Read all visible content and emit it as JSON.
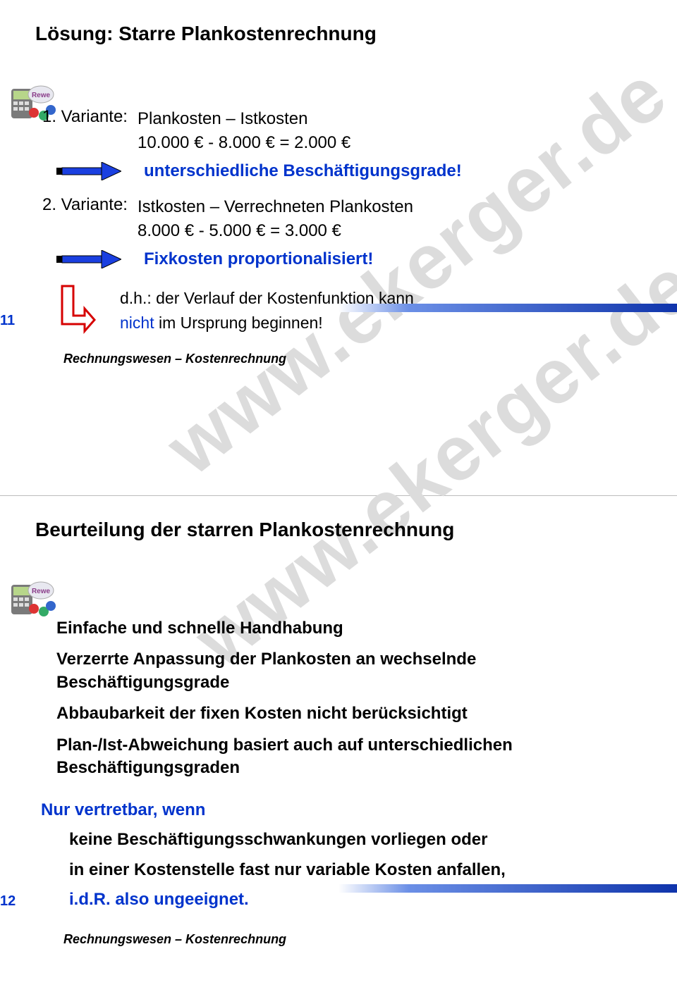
{
  "watermark": "www.ekerger.de",
  "slide1": {
    "title": "Lösung: Starre Plankostenrechnung",
    "var1_label": "1. Variante:",
    "var1_text1": "Plankosten – Istkosten",
    "var1_text2": "10.000 € - 8.000 € = 2.000 €",
    "arrow1_note": "unterschiedliche Beschäftigungsgrade!",
    "var2_label": "2. Variante:",
    "var2_text1": "Istkosten – Verrechneten Plankosten",
    "var2_text2": "8.000 € - 5.000 € = 3.000 €",
    "arrow2_note": "Fixkosten proportionalisiert!",
    "down_note_1": "d.h.: der Verlauf der Kostenfunktion kann",
    "down_note_nicht": "nicht",
    "down_note_2": " im Ursprung beginnen!",
    "footer": "Rechnungswesen – Kostenrechnung",
    "pagenum": "11"
  },
  "slide2": {
    "title": "Beurteilung der starren Plankostenrechnung",
    "bullets": [
      "Einfache und schnelle Handhabung",
      "Verzerrte Anpassung der Plankosten an wechselnde Beschäftigungsgrade",
      "Abbaubarkeit der fixen Kosten nicht berücksichtigt",
      "Plan-/Ist-Abweichung basiert auch auf unterschiedlichen Beschäftigungsgraden"
    ],
    "cond_title": "Nur vertretbar, wenn",
    "cond_line1": "keine Beschäftigungsschwankungen vorliegen oder",
    "cond_line2": "in einer Kostenstelle fast nur variable Kosten anfallen,",
    "cond_line3": "i.d.R. also ungeeignet.",
    "footer": "Rechnungswesen – Kostenrechnung",
    "pagenum": "12"
  }
}
